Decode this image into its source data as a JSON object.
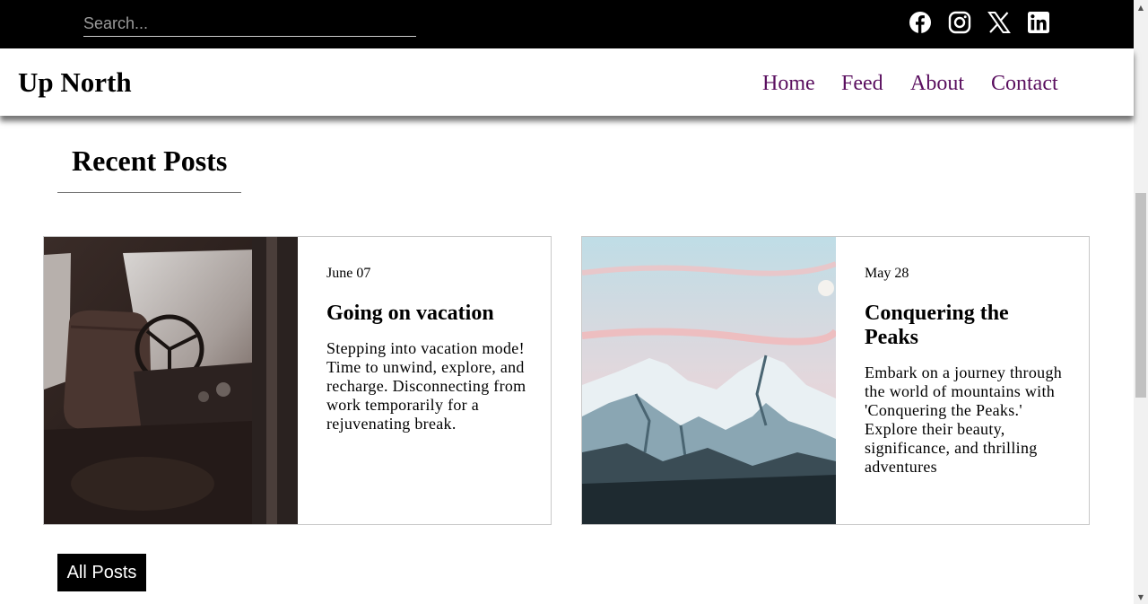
{
  "search": {
    "placeholder": "Search..."
  },
  "social": [
    {
      "icon": "facebook-icon"
    },
    {
      "icon": "instagram-icon"
    },
    {
      "icon": "x-icon"
    },
    {
      "icon": "linkedin-icon"
    }
  ],
  "brand": "Up North",
  "nav": [
    "Home",
    "Feed",
    "About",
    "Contact"
  ],
  "section_title": "Recent Posts",
  "posts": [
    {
      "date": "June 07",
      "title": "Going on vacation",
      "excerpt": "Stepping into vacation mode! Time to unwind, explore, and recharge. Disconnecting from work temporarily for a rejuvenating break.",
      "image": "old-truck-interior-photo"
    },
    {
      "date": "May 28",
      "title": "Conquering the Peaks",
      "excerpt": "Embark on a journey through the world of mountains with 'Conquering the Peaks.' Explore their beauty, significance, and thrilling adventures",
      "image": "snowy-mountains-photo"
    }
  ],
  "all_posts_label": "All Posts",
  "colors": {
    "topbar": "#000000",
    "nav_link": "#5a0f5f",
    "button": "#000000"
  }
}
